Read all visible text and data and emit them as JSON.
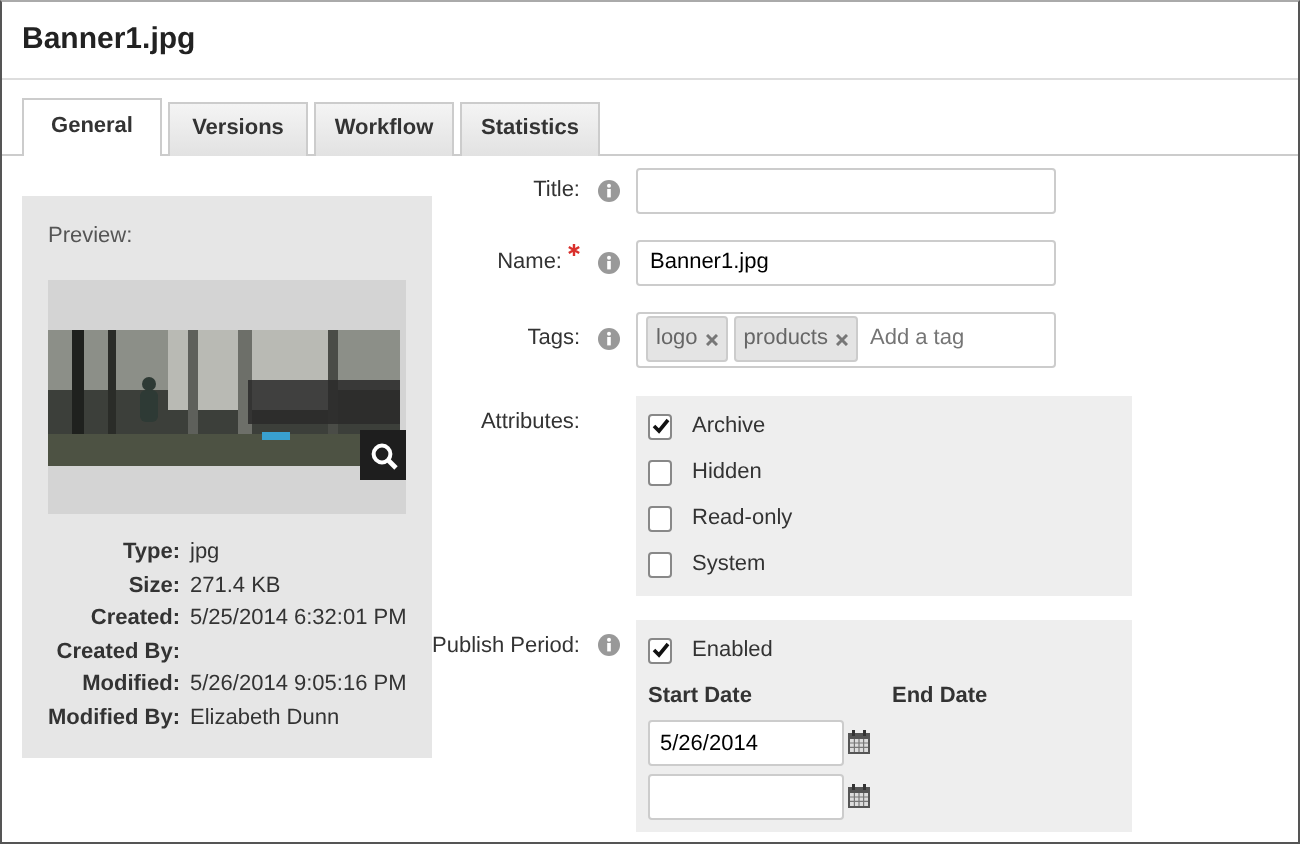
{
  "title": "Banner1.jpg",
  "tabs": [
    {
      "label": "General",
      "selected": true
    },
    {
      "label": "Versions",
      "selected": false
    },
    {
      "label": "Workflow",
      "selected": false
    },
    {
      "label": "Statistics",
      "selected": false
    }
  ],
  "preview": {
    "label": "Preview:"
  },
  "properties": [
    {
      "label": "Type:",
      "value": "jpg"
    },
    {
      "label": "Size:",
      "value": "271.4 KB"
    },
    {
      "label": "Created:",
      "value": "5/25/2014 6:32:01 PM"
    },
    {
      "label": "Created By:"
    },
    {
      "label": "Modified:",
      "value": "5/26/2014 9:05:16 PM"
    },
    {
      "label": "Modified By:",
      "value": "Elizabeth Dunn"
    }
  ],
  "form": {
    "title": {
      "label": "Title:",
      "info": true
    },
    "name": {
      "label": "Name:",
      "required": true,
      "info": true,
      "value": "Banner1.jpg"
    },
    "tags": {
      "label": "Tags:",
      "info": true,
      "items": [
        "logo",
        "products"
      ],
      "placeholder": "Add a tag"
    },
    "attributes": {
      "label": "Attributes:",
      "options": [
        {
          "label": "Archive",
          "checked": true
        },
        {
          "label": "Hidden",
          "checked": false
        },
        {
          "label": "Read-only",
          "checked": false
        },
        {
          "label": "System",
          "checked": false
        }
      ]
    },
    "publish_period": {
      "label": "Publish Period:",
      "info": true,
      "enabled": {
        "label": "Enabled",
        "checked": true
      },
      "start_date": {
        "label": "Start Date",
        "value": "5/26/2014"
      },
      "end_date": {
        "label": "End Date"
      }
    }
  }
}
